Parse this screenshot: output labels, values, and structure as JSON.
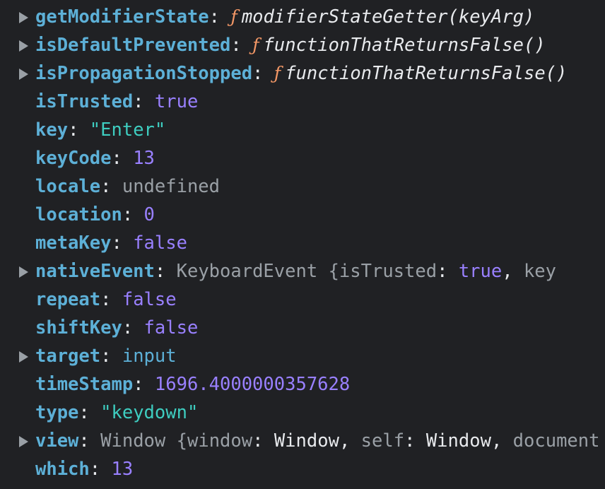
{
  "colors": {
    "background": "#202124",
    "property_key": "#5db0d7",
    "function_f": "#f29766",
    "number_boolean": "#9980ff",
    "string": "#3ecdc0",
    "muted": "#9aa0a6"
  },
  "rows": [
    {
      "key": "getModifierState",
      "expandable": true,
      "f": "ƒ",
      "value": "modifierStateGetter(keyArg)"
    },
    {
      "key": "isDefaultPrevented",
      "expandable": true,
      "f": "ƒ",
      "value": "functionThatReturnsFalse()"
    },
    {
      "key": "isPropagationStopped",
      "expandable": true,
      "f": "ƒ",
      "value": "functionThatReturnsFalse()"
    },
    {
      "key": "isTrusted",
      "value": "true"
    },
    {
      "key": "key",
      "value": "\"Enter\""
    },
    {
      "key": "keyCode",
      "value": "13"
    },
    {
      "key": "locale",
      "value": "undefined"
    },
    {
      "key": "location",
      "value": "0"
    },
    {
      "key": "metaKey",
      "value": "false"
    },
    {
      "key": "nativeEvent",
      "expandable": true,
      "value_type": "KeyboardEvent",
      "preview_open": "{",
      "preview_key": "isTrusted",
      "preview_value": "true",
      "preview_rest": "key"
    },
    {
      "key": "repeat",
      "value": "false"
    },
    {
      "key": "shiftKey",
      "value": "false"
    },
    {
      "key": "target",
      "expandable": true,
      "value": "input"
    },
    {
      "key": "timeStamp",
      "value": "1696.4000000357628"
    },
    {
      "key": "type",
      "value": "\"keydown\""
    },
    {
      "key": "view",
      "expandable": true,
      "value_type": "Window",
      "preview_open": "{",
      "p1_key": "window",
      "p1_value": "Window",
      "p2_key": "self",
      "p2_value": "Window",
      "preview_rest": "document"
    },
    {
      "key": "which",
      "value": "13"
    }
  ],
  "punct": {
    "colon": ": ",
    "comma": ", "
  }
}
